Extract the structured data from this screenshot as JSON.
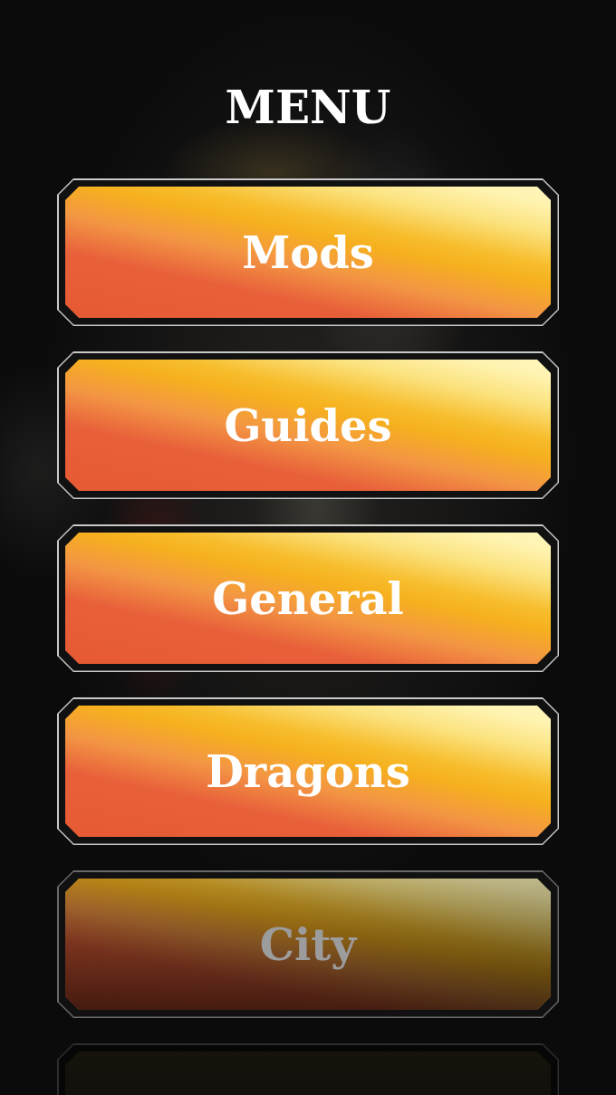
{
  "title": "MENU",
  "menu": {
    "items": [
      {
        "label": "Mods",
        "dimmed": false
      },
      {
        "label": "Guides",
        "dimmed": false
      },
      {
        "label": "General",
        "dimmed": false
      },
      {
        "label": "Dragons",
        "dimmed": false
      },
      {
        "label": "City",
        "dimmed": true
      }
    ],
    "more_below": true
  }
}
